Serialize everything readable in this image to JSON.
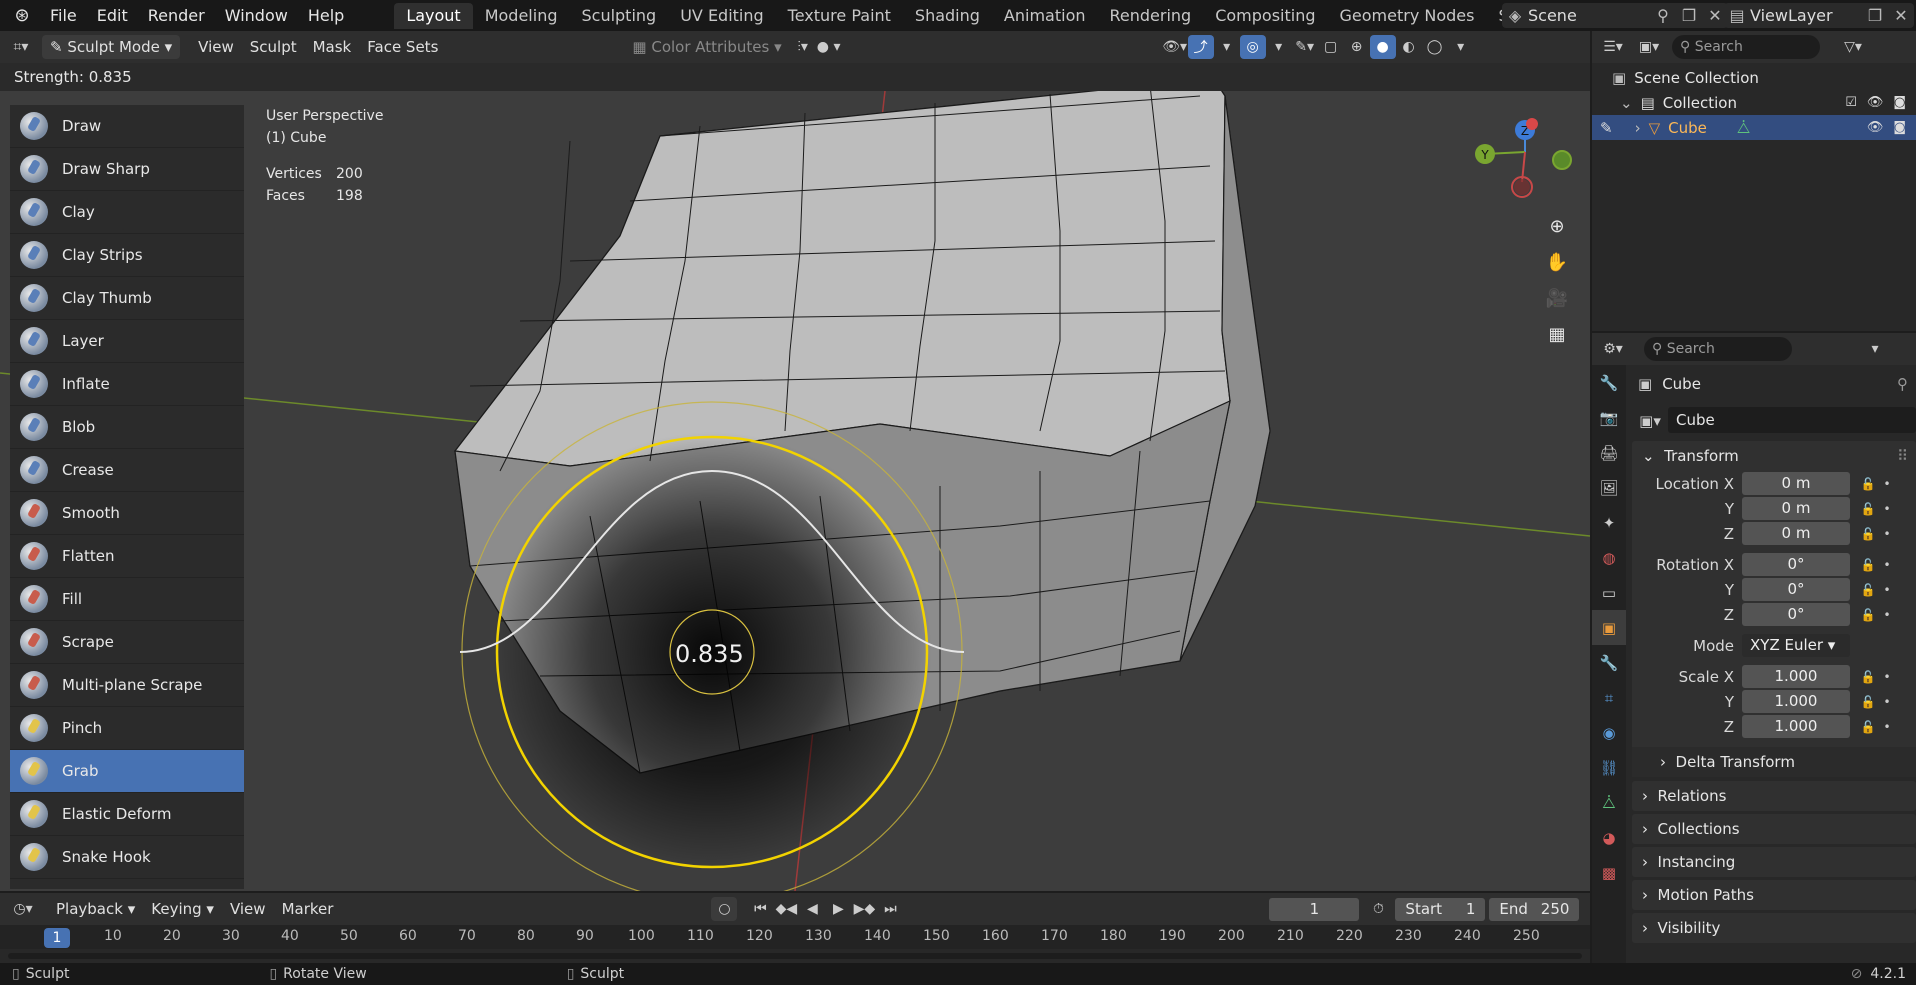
{
  "menu": [
    "File",
    "Edit",
    "Render",
    "Window",
    "Help"
  ],
  "workspaces": [
    "Layout",
    "Modeling",
    "Sculpting",
    "UV Editing",
    "Texture Paint",
    "Shading",
    "Animation",
    "Rendering",
    "Compositing",
    "Geometry Nodes",
    "Scripting"
  ],
  "active_workspace": "Layout",
  "scene": "Scene",
  "view_layer": "ViewLayer",
  "header": {
    "mode": "Sculpt Mode",
    "menus": [
      "View",
      "Sculpt",
      "Mask",
      "Face Sets"
    ],
    "color_attributes": "Color Attributes"
  },
  "tool_settings": {
    "strength": "Strength: 0.835"
  },
  "viewport": {
    "perspective": "User Perspective",
    "object": "(1) Cube",
    "vertices_label": "Vertices",
    "vertices": "200",
    "faces_label": "Faces",
    "faces": "198",
    "brush_value": "0.835"
  },
  "brushes": [
    {
      "label": "Draw",
      "color": "blue"
    },
    {
      "label": "Draw Sharp",
      "color": "blue"
    },
    {
      "label": "Clay",
      "color": "blue"
    },
    {
      "label": "Clay Strips",
      "color": "blue"
    },
    {
      "label": "Clay Thumb",
      "color": "blue"
    },
    {
      "label": "Layer",
      "color": "blue"
    },
    {
      "label": "Inflate",
      "color": "blue"
    },
    {
      "label": "Blob",
      "color": "blue"
    },
    {
      "label": "Crease",
      "color": "blue"
    },
    {
      "label": "Smooth",
      "color": "red"
    },
    {
      "label": "Flatten",
      "color": "red"
    },
    {
      "label": "Fill",
      "color": "red"
    },
    {
      "label": "Scrape",
      "color": "red"
    },
    {
      "label": "Multi-plane Scrape",
      "color": "red"
    },
    {
      "label": "Pinch",
      "color": "yellow"
    },
    {
      "label": "Grab",
      "color": "yellow"
    },
    {
      "label": "Elastic Deform",
      "color": "yellow"
    },
    {
      "label": "Snake Hook",
      "color": "yellow"
    }
  ],
  "active_brush": "Grab",
  "gizmo": {
    "z": "Z",
    "y": "Y"
  },
  "outliner": {
    "search_placeholder": "Search",
    "scene_collection": "Scene Collection",
    "collection": "Collection",
    "object": "Cube"
  },
  "properties": {
    "search_placeholder": "Search",
    "title": "Cube",
    "name": "Cube",
    "transform_label": "Transform",
    "location_label": "Location X",
    "location": [
      "0 m",
      "0 m",
      "0 m"
    ],
    "rotation_label": "Rotation X",
    "rotation": [
      "0°",
      "0°",
      "0°"
    ],
    "axis_y": "Y",
    "axis_z": "Z",
    "mode_label": "Mode",
    "mode": "XYZ Euler",
    "scale_label": "Scale X",
    "scale": [
      "1.000",
      "1.000",
      "1.000"
    ],
    "delta_transform": "Delta Transform",
    "sections": [
      "Relations",
      "Collections",
      "Instancing",
      "Motion Paths",
      "Visibility"
    ]
  },
  "timeline": {
    "menus": [
      "Playback",
      "Keying",
      "View",
      "Marker"
    ],
    "current_frame": "1",
    "start_label": "Start",
    "start": "1",
    "end_label": "End",
    "end": "250",
    "ticks": [
      "1",
      "10",
      "20",
      "30",
      "40",
      "50",
      "60",
      "70",
      "80",
      "90",
      "100",
      "110",
      "120",
      "130",
      "140",
      "150",
      "160",
      "170",
      "180",
      "190",
      "200",
      "210",
      "220",
      "230",
      "240",
      "250"
    ]
  },
  "statusbar": {
    "left": "Sculpt",
    "middle": "Rotate View",
    "right": "Sculpt",
    "version": "4.2.1"
  }
}
